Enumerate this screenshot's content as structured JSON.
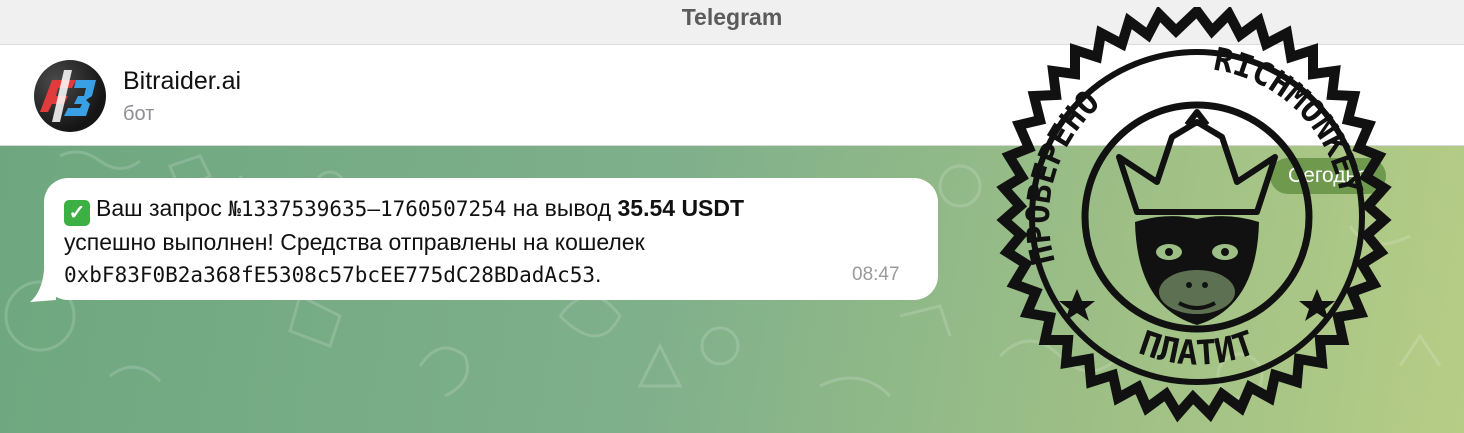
{
  "window": {
    "title": "Telegram"
  },
  "chat": {
    "name": "Bitraider.ai",
    "status": "бот"
  },
  "date_divider": "Сегодня",
  "message": {
    "icon": "check-mark-emoji",
    "prefix": "Ваш запрос ",
    "request_id": "№1337539635–1760507254",
    "middle": " на вывод ",
    "amount": "35.54 USDT",
    "line2": "успешно выполнен! Средства отправлены на кошелек",
    "wallet": "0xbF83F0B2a368fE5308c57bcEE775dC28BDadAc53",
    "wallet_suffix": ".",
    "time": "08:47"
  },
  "stamp": {
    "top_left_text": "ПРОВЕРЕНО",
    "top_right_text": "RICHMONKEY",
    "bottom_text": "ПЛАТИТ"
  },
  "colors": {
    "stamp": "#111111",
    "chat_bg_start": "#6ea77f",
    "chat_bg_end": "#b6cd86",
    "pill": "#6f9a4e",
    "bubble": "#ffffff"
  }
}
